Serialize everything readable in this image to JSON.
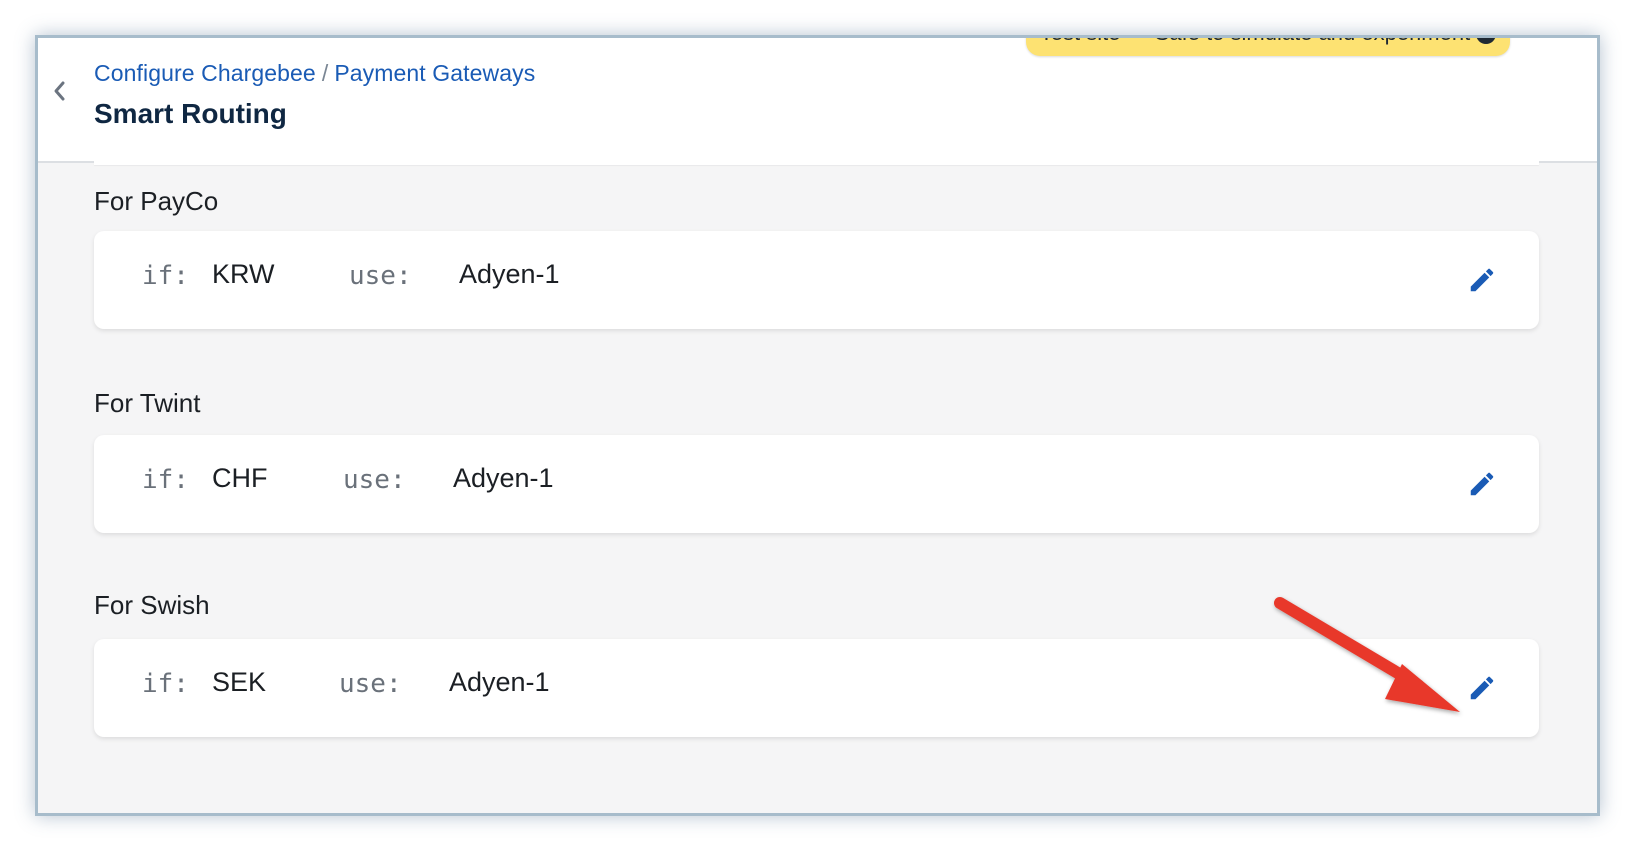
{
  "header": {
    "breadcrumb": [
      "Configure Chargebee",
      "Payment Gateways"
    ],
    "separator": "/",
    "title": "Smart Routing",
    "test_banner": "Test site — Safe to simulate and experiment"
  },
  "rule_labels": {
    "if": "if:",
    "use": "use:"
  },
  "rules": [
    {
      "label": "For PayCo",
      "if_value": "KRW",
      "use_value": "Adyen-1"
    },
    {
      "label": "For Twint",
      "if_value": "CHF",
      "use_value": "Adyen-1"
    },
    {
      "label": "For Swish",
      "if_value": "SEK",
      "use_value": "Adyen-1"
    }
  ],
  "colors": {
    "link": "#1a5bb5",
    "title": "#0f2742",
    "banner": "#fde272",
    "annotation_arrow": "#e8382b"
  },
  "icons": {
    "back": "chevron-left-icon",
    "edit": "pencil-icon",
    "annotation": "red-arrow"
  }
}
